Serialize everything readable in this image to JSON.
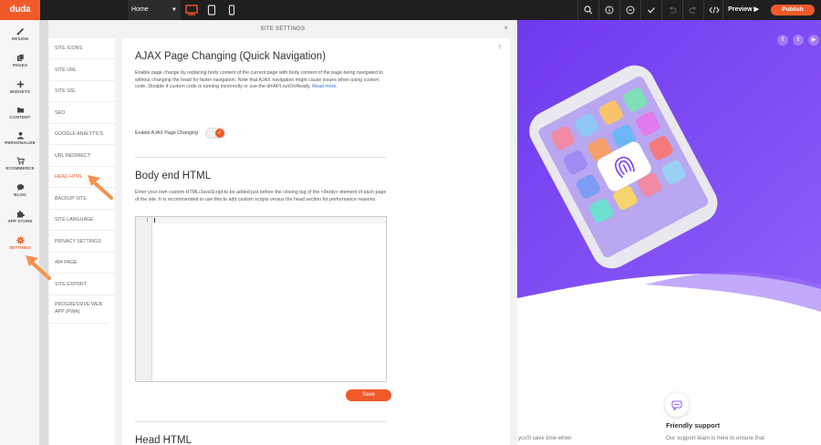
{
  "app": {
    "logo": "duda",
    "brand_color": "#f05a28"
  },
  "topbar": {
    "page_select": "Home",
    "devices": [
      "desktop-icon",
      "tablet-icon",
      "mobile-icon"
    ],
    "active_device": "desktop",
    "tools": [
      "search-icon",
      "info-icon",
      "chat-icon",
      "check-icon",
      "undo-icon",
      "redo-icon",
      "code-icon"
    ],
    "preview_label": "Preview",
    "publish_label": "Publish"
  },
  "rail": {
    "items": [
      {
        "label": "DESIGN",
        "icon": "brush-icon"
      },
      {
        "label": "PAGES",
        "icon": "pages-icon"
      },
      {
        "label": "WIDGETS",
        "icon": "plus-icon"
      },
      {
        "label": "CONTENT",
        "icon": "folder-icon"
      },
      {
        "label": "PERSONALIZE",
        "icon": "person-icon"
      },
      {
        "label": "ECOMMERCE",
        "icon": "cart-icon"
      },
      {
        "label": "BLOG",
        "icon": "comment-icon"
      },
      {
        "label": "APP STORE",
        "icon": "puzzle-icon"
      },
      {
        "label": "SETTINGS",
        "icon": "gear-icon"
      }
    ],
    "active": "SETTINGS"
  },
  "panel": {
    "title": "SITE SETTINGS",
    "close": "×",
    "help": "?",
    "menu": [
      "SITE ICONS",
      "SITE URL",
      "SITE SSL",
      "SEO",
      "GOOGLE ANALYTICS",
      "URL REDIRECT",
      "HEAD HTML",
      "BACKUP SITE",
      "SITE LANGUAGE",
      "PRIVACY SETTINGS",
      "404 PAGE",
      "SITE EXPORT",
      "PROGRESSIVE WEB APP (PWA)"
    ],
    "active_menu": "HEAD HTML",
    "ajax": {
      "title": "AJAX Page Changing (Quick Navigation)",
      "desc_1": "Enable page change by replacing body content of the current page with body content of the page being navigated to without changing the head for faster navigation.",
      "desc_2": "Note that AJAX navigation might cause issues when using custom code. Disable if custom code is running incorrectly or use the dmAPI.runOnReady.",
      "read_more": "Read more.",
      "toggle_label": "Enable AJAX Page Changing",
      "toggle_on": true
    },
    "body_end": {
      "title": "Body end HTML",
      "desc": "Enter your own custom HTML/JavaScript to be added just before the closing tag of the </body> element of each page of the site. It is recommended to use this to add custom scripts versus the head section for performance reasons.",
      "line_number": "1",
      "code_value": "",
      "save_label": "Save"
    },
    "head": {
      "title": "Head HTML"
    }
  },
  "site": {
    "hero_color": "#7a3ff0",
    "social": [
      "f",
      "t",
      "▶"
    ],
    "support_title": "Friendly support",
    "support_text": "Our support team is here to ensure that",
    "left_text": "you'll save time when"
  }
}
